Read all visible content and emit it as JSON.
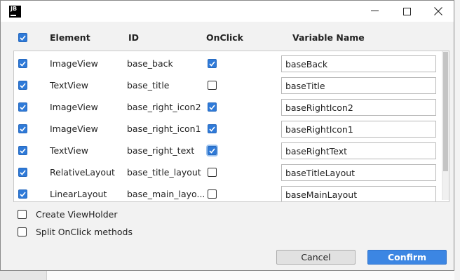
{
  "window": {
    "app_icon_text": "JB",
    "minimize_icon": "minimize-icon",
    "maximize_icon": "maximize-icon",
    "close_icon": "close-icon"
  },
  "table": {
    "headers": {
      "element": "Element",
      "id": "ID",
      "onclick": "OnClick",
      "variable_name": "Variable Name"
    },
    "select_all_checked": true,
    "rows": [
      {
        "checked": true,
        "element": "ImageView",
        "id": "base_back",
        "onclick": true,
        "variable": "baseBack"
      },
      {
        "checked": true,
        "element": "TextView",
        "id": "base_title",
        "onclick": false,
        "variable": "baseTitle"
      },
      {
        "checked": true,
        "element": "ImageView",
        "id": "base_right_icon2",
        "onclick": true,
        "variable": "baseRightIcon2"
      },
      {
        "checked": true,
        "element": "ImageView",
        "id": "base_right_icon1",
        "onclick": true,
        "variable": "baseRightIcon1"
      },
      {
        "checked": true,
        "element": "TextView",
        "id": "base_right_text",
        "onclick": true,
        "variable": "baseRightText"
      },
      {
        "checked": true,
        "element": "RelativeLayout",
        "id": "base_title_layout",
        "onclick": false,
        "variable": "baseTitleLayout"
      },
      {
        "checked": true,
        "element": "LinearLayout",
        "id": "base_main_layo...",
        "onclick": false,
        "variable": "baseMainLayout"
      }
    ]
  },
  "options": {
    "create_viewholder": {
      "label": "Create ViewHolder",
      "checked": false
    },
    "split_onclick": {
      "label": "Split OnClick methods",
      "checked": false
    }
  },
  "buttons": {
    "cancel": "Cancel",
    "confirm": "Confirm"
  },
  "colors": {
    "accent": "#3c86e3",
    "checkbox_checked": "#2f7ad8"
  }
}
